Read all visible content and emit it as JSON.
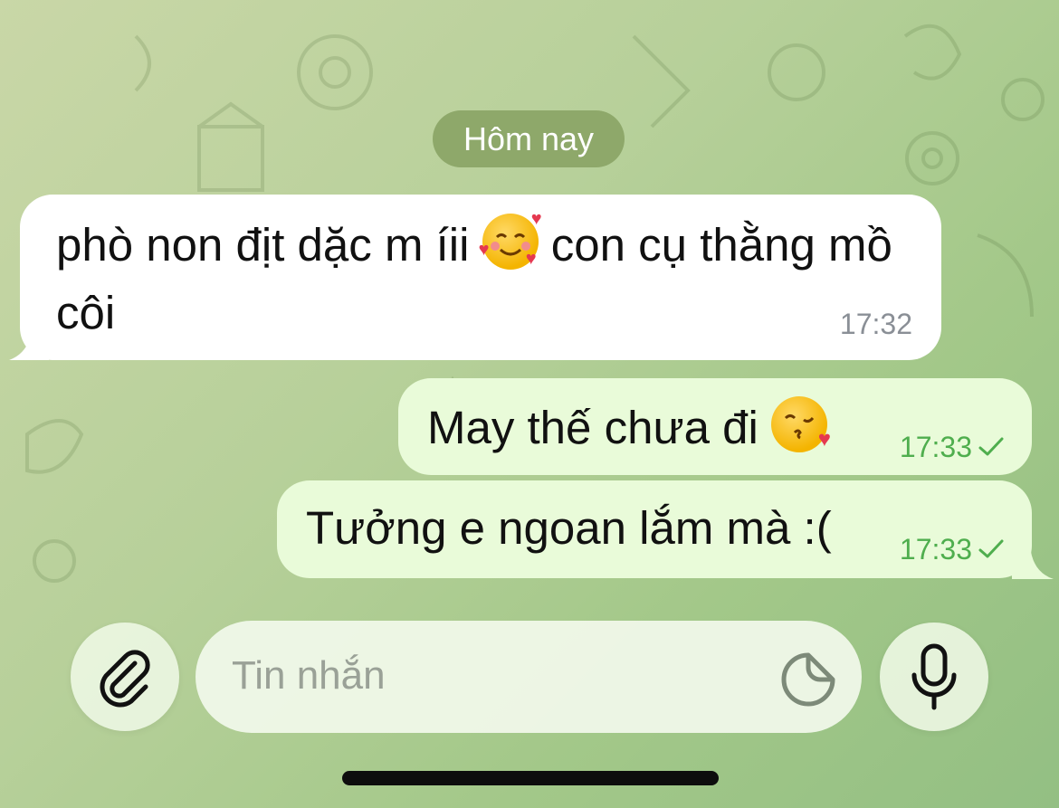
{
  "date_separator": "Hôm nay",
  "messages": [
    {
      "direction": "incoming",
      "text_before_emoji": "phò non địt dặc m íii",
      "emoji": "smiling-face-with-hearts",
      "text_after_emoji": "con cụ thằng mồ côi",
      "time": "17:32"
    },
    {
      "direction": "outgoing",
      "text": "May thế chưa đi",
      "emoji": "face-blowing-a-kiss",
      "time": "17:33",
      "status": "sent"
    },
    {
      "direction": "outgoing",
      "text": "Tưởng e ngoan lắm mà :(",
      "time": "17:33",
      "status": "sent"
    }
  ],
  "composer": {
    "placeholder": "Tin nhắn",
    "attach_icon": "paperclip-icon",
    "sticker_icon": "sticker-icon",
    "mic_icon": "microphone-icon"
  },
  "colors": {
    "incoming_bubble": "#ffffff",
    "outgoing_bubble": "#e9fbd9",
    "checkmark": "#4fae4e",
    "date_pill": "#8ea86a"
  }
}
